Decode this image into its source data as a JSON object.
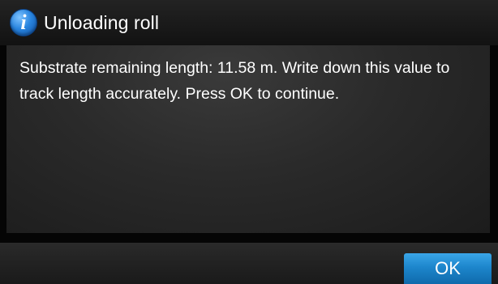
{
  "dialog": {
    "title": "Unloading roll",
    "icon": "info-icon",
    "icon_glyph": "i",
    "message": "Substrate remaining length: 11.58 m. Write down this value to track length accurately. Press OK to continue."
  },
  "actions": {
    "ok_label": "OK"
  },
  "colors": {
    "accent": "#1d86cc",
    "icon_blue": "#2a86e0",
    "text": "#ffffff"
  }
}
